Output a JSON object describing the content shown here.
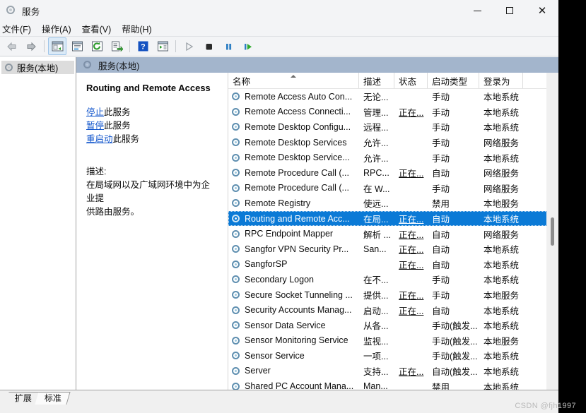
{
  "window": {
    "title": "服务",
    "icon": "services-gear-icon",
    "minimize_label": "最小化",
    "maximize_label": "最大化",
    "close_label": "关闭"
  },
  "menubar": [
    {
      "name": "file",
      "label": "文件(F)"
    },
    {
      "name": "action",
      "label": "操作(A)"
    },
    {
      "name": "view",
      "label": "查看(V)"
    },
    {
      "name": "help",
      "label": "帮助(H)"
    }
  ],
  "toolbar": [
    {
      "name": "back-button",
      "icon": "arrow-left-icon",
      "state": "disabled"
    },
    {
      "name": "forward-button",
      "icon": "arrow-right-icon",
      "state": "enabled"
    },
    {
      "name": "separator-1",
      "icon": "separator",
      "state": "static"
    },
    {
      "name": "show-hide-tree-button",
      "icon": "tree-panel-icon",
      "state": "active"
    },
    {
      "name": "properties-button",
      "icon": "properties-window-icon",
      "state": "enabled"
    },
    {
      "name": "refresh-button",
      "icon": "refresh-circular-arrow-icon",
      "state": "enabled"
    },
    {
      "name": "export-list-button",
      "icon": "export-list-icon",
      "state": "enabled"
    },
    {
      "name": "separator-2",
      "icon": "separator",
      "state": "static"
    },
    {
      "name": "help-button",
      "icon": "question-mark-icon",
      "state": "enabled"
    },
    {
      "name": "show-action-pane-button",
      "icon": "action-pane-icon",
      "state": "enabled"
    },
    {
      "name": "separator-3",
      "icon": "separator",
      "state": "static"
    },
    {
      "name": "start-service-button",
      "icon": "play-triangle-icon",
      "state": "disabled"
    },
    {
      "name": "stop-service-button",
      "icon": "stop-square-icon",
      "state": "enabled"
    },
    {
      "name": "pause-service-button",
      "icon": "pause-bars-icon",
      "state": "enabled"
    },
    {
      "name": "restart-service-button",
      "icon": "restart-play-icon",
      "state": "enabled"
    }
  ],
  "tree": {
    "root_label": "服务(本地)",
    "root_icon": "services-gear-icon"
  },
  "pane_header": {
    "label": "服务(本地)",
    "icon": "services-gear-icon"
  },
  "detail": {
    "service_title": "Routing and Remote Access",
    "actions": [
      {
        "name": "stop-service-link",
        "link": "停止",
        "suffix": "此服务"
      },
      {
        "name": "pause-service-link",
        "link": "暂停",
        "suffix": "此服务"
      },
      {
        "name": "restart-service-link",
        "link": "重启动",
        "suffix": "此服务"
      }
    ],
    "description_label": "描述:",
    "description_lines": [
      "在局域网以及广域网环境中为企业提",
      "供路由服务。"
    ]
  },
  "list": {
    "columns": [
      {
        "name": "column-name",
        "label": "名称",
        "sorted": "asc"
      },
      {
        "name": "column-description",
        "label": "描述",
        "sorted": ""
      },
      {
        "name": "column-status",
        "label": "状态",
        "sorted": ""
      },
      {
        "name": "column-startup",
        "label": "启动类型",
        "sorted": ""
      },
      {
        "name": "column-logon",
        "label": "登录为",
        "sorted": ""
      }
    ],
    "rows": [
      {
        "name": "Remote Access Auto Con...",
        "description": "无论...",
        "status": "",
        "startup": "手动",
        "logon": "本地系统",
        "selected": false
      },
      {
        "name": "Remote Access Connecti...",
        "description": "管理...",
        "status": "正在...",
        "startup": "手动",
        "logon": "本地系统",
        "selected": false
      },
      {
        "name": "Remote Desktop Configu...",
        "description": "远程...",
        "status": "",
        "startup": "手动",
        "logon": "本地系统",
        "selected": false
      },
      {
        "name": "Remote Desktop Services",
        "description": "允许...",
        "status": "",
        "startup": "手动",
        "logon": "网络服务",
        "selected": false
      },
      {
        "name": "Remote Desktop Service...",
        "description": "允许...",
        "status": "",
        "startup": "手动",
        "logon": "本地系统",
        "selected": false
      },
      {
        "name": "Remote Procedure Call (...",
        "description": "RPC...",
        "status": "正在...",
        "startup": "自动",
        "logon": "网络服务",
        "selected": false
      },
      {
        "name": "Remote Procedure Call (...",
        "description": "在 W...",
        "status": "",
        "startup": "手动",
        "logon": "网络服务",
        "selected": false
      },
      {
        "name": "Remote Registry",
        "description": "使远...",
        "status": "",
        "startup": "禁用",
        "logon": "本地服务",
        "selected": false
      },
      {
        "name": "Routing and Remote Acc...",
        "description": "在局...",
        "status": "正在...",
        "startup": "自动",
        "logon": "本地系统",
        "selected": true
      },
      {
        "name": "RPC Endpoint Mapper",
        "description": "解析 ...",
        "status": "正在...",
        "startup": "自动",
        "logon": "网络服务",
        "selected": false
      },
      {
        "name": "Sangfor VPN Security Pr...",
        "description": "San...",
        "status": "正在...",
        "startup": "自动",
        "logon": "本地系统",
        "selected": false
      },
      {
        "name": "SangforSP",
        "description": "",
        "status": "正在...",
        "startup": "自动",
        "logon": "本地系统",
        "selected": false
      },
      {
        "name": "Secondary Logon",
        "description": "在不...",
        "status": "",
        "startup": "手动",
        "logon": "本地系统",
        "selected": false
      },
      {
        "name": "Secure Socket Tunneling ...",
        "description": "提供...",
        "status": "正在...",
        "startup": "手动",
        "logon": "本地服务",
        "selected": false
      },
      {
        "name": "Security Accounts Manag...",
        "description": "启动...",
        "status": "正在...",
        "startup": "自动",
        "logon": "本地系统",
        "selected": false
      },
      {
        "name": "Sensor Data Service",
        "description": "从各...",
        "status": "",
        "startup": "手动(触发...",
        "logon": "本地系统",
        "selected": false
      },
      {
        "name": "Sensor Monitoring Service",
        "description": "监视...",
        "status": "",
        "startup": "手动(触发...",
        "logon": "本地服务",
        "selected": false
      },
      {
        "name": "Sensor Service",
        "description": "一项...",
        "status": "",
        "startup": "手动(触发...",
        "logon": "本地系统",
        "selected": false
      },
      {
        "name": "Server",
        "description": "支持...",
        "status": "正在...",
        "startup": "自动(触发...",
        "logon": "本地系统",
        "selected": false
      },
      {
        "name": "Shared PC Account Mana...",
        "description": "Man...",
        "status": "",
        "startup": "禁用",
        "logon": "本地系统",
        "selected": false
      }
    ]
  },
  "tabs": [
    {
      "name": "tab-extended",
      "label": "扩展",
      "active": false
    },
    {
      "name": "tab-standard",
      "label": "标准",
      "active": true
    }
  ],
  "watermark": "CSDN @fjh1997",
  "colors": {
    "selection_blue": "#0b7ad6",
    "pane_header_blue": "#a3b5cc",
    "link_blue": "#1155cc",
    "chrome_gray": "#f0f0f0"
  }
}
